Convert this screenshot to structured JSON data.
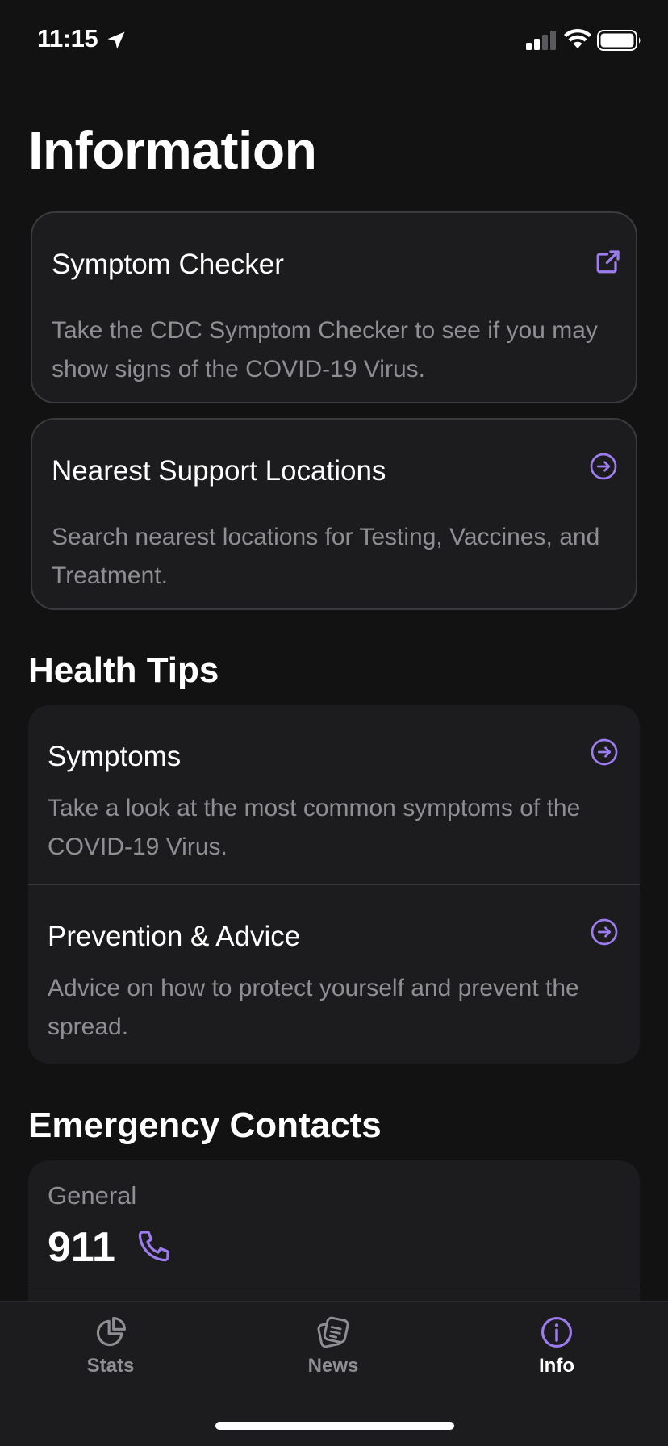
{
  "status_bar": {
    "time": "11:15"
  },
  "page": {
    "title": "Information"
  },
  "cards": {
    "symptom_checker": {
      "title": "Symptom Checker",
      "description": "Take the CDC Symptom Checker to see if you may show signs of the COVID-19 Virus.",
      "icon": "external-link-icon"
    },
    "support_locations": {
      "title": "Nearest Support Locations",
      "description": "Search nearest locations for Testing, Vaccines, and Treatment.",
      "icon": "arrow-right-circle-icon"
    }
  },
  "health_tips": {
    "title": "Health Tips",
    "items": [
      {
        "title": "Symptoms",
        "description": "Take a look at the most common symptoms of the COVID-19 Virus.",
        "icon": "arrow-right-circle-icon"
      },
      {
        "title": "Prevention & Advice",
        "description": "Advice on how to protect yourself and prevent the spread.",
        "icon": "arrow-right-circle-icon"
      }
    ]
  },
  "emergency": {
    "title": "Emergency Contacts",
    "contacts": [
      {
        "label": "General",
        "number": "911",
        "icon": "phone-icon"
      }
    ]
  },
  "tab_bar": {
    "tabs": [
      {
        "label": "Stats",
        "icon": "pie-chart-icon",
        "active": false
      },
      {
        "label": "News",
        "icon": "news-icon",
        "active": false
      },
      {
        "label": "Info",
        "icon": "info-icon",
        "active": true
      }
    ]
  },
  "colors": {
    "accent": "#9d7cf0",
    "background": "#121212",
    "card": "#1c1c1e",
    "secondary_text": "#8e8e93"
  }
}
